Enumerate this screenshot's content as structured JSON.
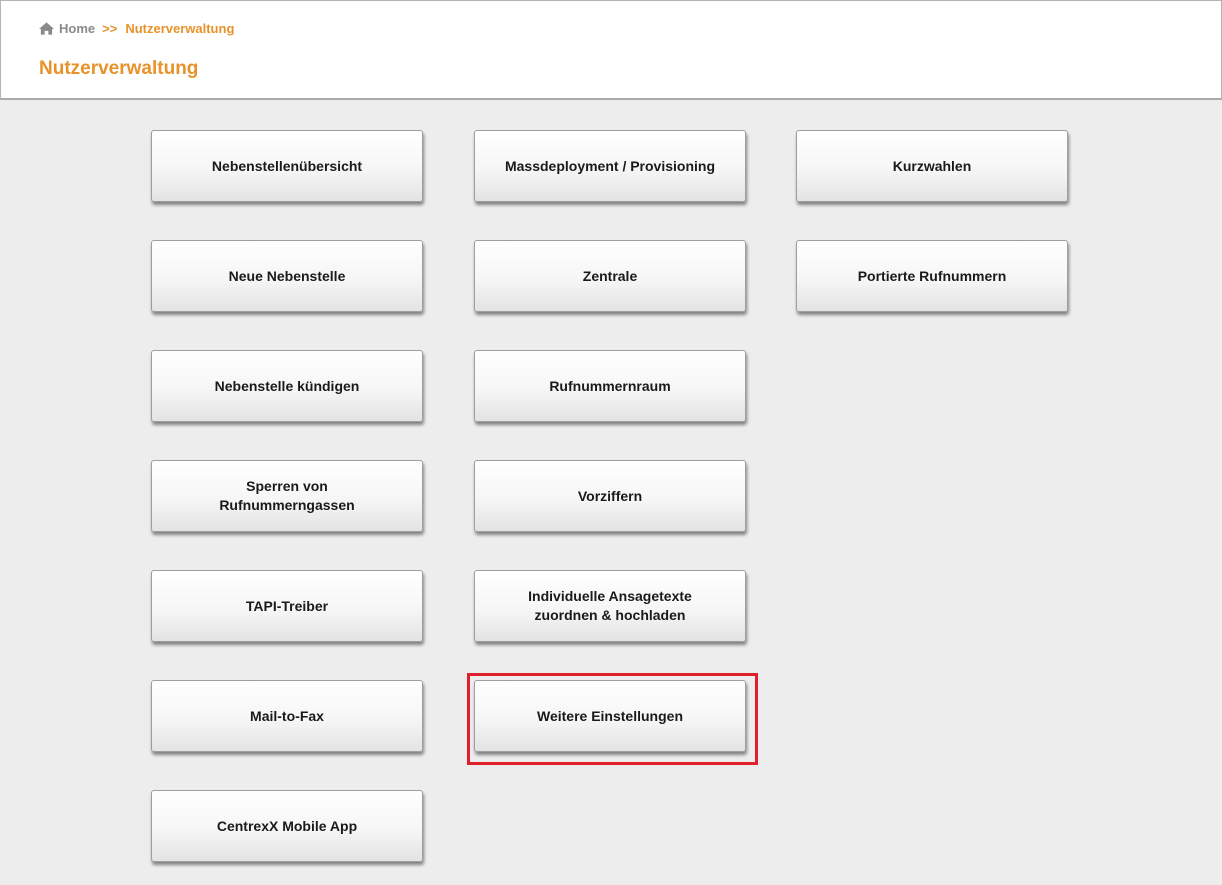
{
  "breadcrumb": {
    "home_icon": "home-icon",
    "home_label": "Home",
    "separator": ">>",
    "current": "Nutzerverwaltung"
  },
  "page": {
    "title": "Nutzerverwaltung"
  },
  "colors": {
    "accent": "#e8922a",
    "highlight": "#e0202a",
    "background": "#ededed"
  },
  "tiles": {
    "nebenstellenuebersicht": "Nebenstellenübersicht",
    "neue_nebenstelle": "Neue Nebenstelle",
    "nebenstelle_kuendigen": "Nebenstelle kündigen",
    "sperren_line1": "Sperren von",
    "sperren_line2": "Rufnummerngassen",
    "tapi_treiber": "TAPI-Treiber",
    "mail_to_fax": "Mail-to-Fax",
    "centrexx_mobile_app": "CentrexX Mobile App",
    "massdeployment": "Massdeployment / Provisioning",
    "zentrale": "Zentrale",
    "rufnummernraum": "Rufnummernraum",
    "vorziffern": "Vorziffern",
    "ansagetexte_line1": "Individuelle Ansagetexte",
    "ansagetexte_line2": "zuordnen & hochladen",
    "weitere_einstellungen": "Weitere Einstellungen",
    "kurzwahlen": "Kurzwahlen",
    "portierte_rufnummern": "Portierte Rufnummern"
  }
}
